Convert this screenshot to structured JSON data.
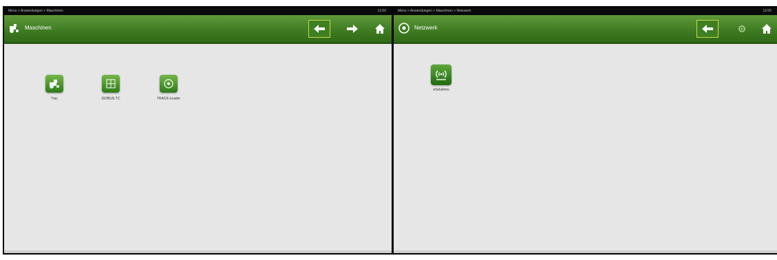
{
  "left": {
    "statusbar_text": "Menu > Anwendungen > Maschinen",
    "statusbar_time": "12:00",
    "header_title": "Maschinen",
    "apps": [
      {
        "label": "Trac",
        "icon": "tractor-icon"
      },
      {
        "label": "ISOBUS-TC",
        "icon": "field-icon"
      },
      {
        "label": "TRACK-Leader",
        "icon": "guidance-icon"
      }
    ]
  },
  "right": {
    "statusbar_text": "Menu > Anwendungen > Maschinen > Netzwerk",
    "statusbar_time": "12:00",
    "header_title": "Netzwerk",
    "apps": [
      {
        "label": "eSolutions",
        "icon": "wireless-signal-icon"
      }
    ]
  },
  "colors": {
    "header_green": "#3d7a21",
    "highlight_border": "#c8d94a",
    "background": "#e6e6e6"
  }
}
